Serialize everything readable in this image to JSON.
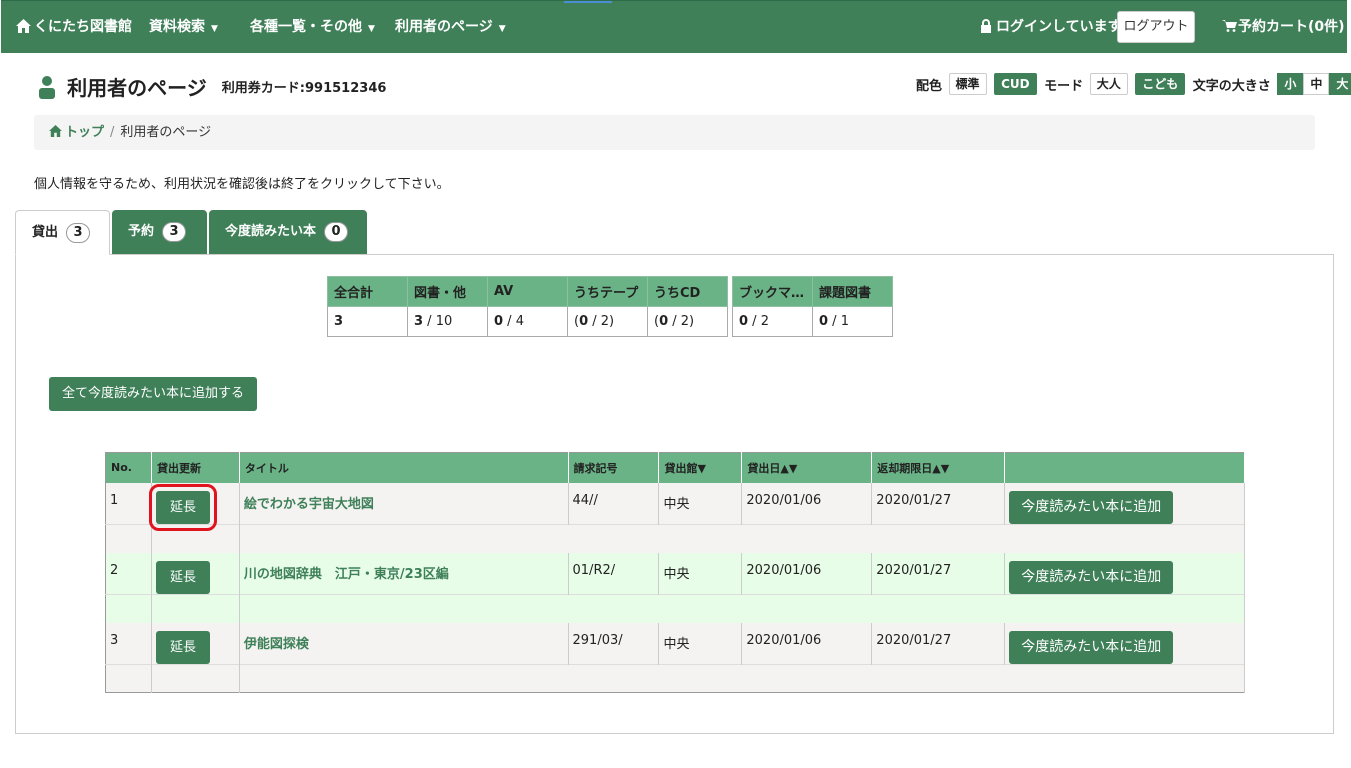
{
  "nav": {
    "home": "くにたち図書館",
    "items": [
      "資料検索",
      "各種一覧・その他",
      "利用者のページ"
    ],
    "login_status": "ログインしています",
    "logout": "ログアウト",
    "cart": "予約カート(0件)"
  },
  "page": {
    "title": "利用者のページ",
    "card_no": "利用券カード:991512346"
  },
  "options": {
    "color_label": "配色",
    "color_standard": "標準",
    "color_cud": "CUD",
    "mode_label": "モード",
    "mode_adult": "大人",
    "mode_child": "こども",
    "size_label": "文字の大きさ",
    "size_small": "小",
    "size_medium": "中",
    "size_large": "大"
  },
  "breadcrumb": {
    "home": "トップ",
    "sep": "/",
    "current": "利用者のページ"
  },
  "notice": "個人情報を守るため、利用状況を確認後は終了をクリックして下さい。",
  "tabs": [
    {
      "label": "貸出",
      "count": "3"
    },
    {
      "label": "予約",
      "count": "3"
    },
    {
      "label": "今度読みたい本",
      "count": "0"
    }
  ],
  "summary1": {
    "headers": [
      "全合計",
      "図書・他",
      "AV",
      "うちテープ",
      "うちCD"
    ],
    "cells": [
      {
        "b": "3",
        "r": ""
      },
      {
        "b": "3",
        "r": " / 10"
      },
      {
        "b": "0",
        "r": " / 4"
      },
      {
        "p": "(",
        "b": "0",
        "r": " / 2)"
      },
      {
        "p": "(",
        "b": "0",
        "r": " / 2)"
      }
    ]
  },
  "summary2": {
    "headers": [
      "ブックマ…",
      "課題図書"
    ],
    "cells": [
      {
        "b": "0",
        "r": " / 2"
      },
      {
        "b": "0",
        "r": " / 1"
      }
    ]
  },
  "add_all_button": "全て今度読みたい本に追加する",
  "loan_table": {
    "headers": [
      "No.",
      "貸出更新",
      "タイトル",
      "請求記号",
      "貸出館▼",
      "貸出日▲▼",
      "返却期限日▲▼",
      ""
    ],
    "extend_label": "延長",
    "want_label": "今度読みたい本に追加",
    "rows": [
      {
        "no": "1",
        "title": "絵でわかる宇宙大地図",
        "call": "44//",
        "branch": "中央",
        "loan": "2020/01/06",
        "due": "2020/01/27"
      },
      {
        "no": "2",
        "title": "川の地図辞典　江戸・東京/23区編",
        "call": "01/R2/",
        "branch": "中央",
        "loan": "2020/01/06",
        "due": "2020/01/27"
      },
      {
        "no": "3",
        "title": "伊能図探検",
        "call": "291/03/",
        "branch": "中央",
        "loan": "2020/01/06",
        "due": "2020/01/27"
      }
    ]
  }
}
